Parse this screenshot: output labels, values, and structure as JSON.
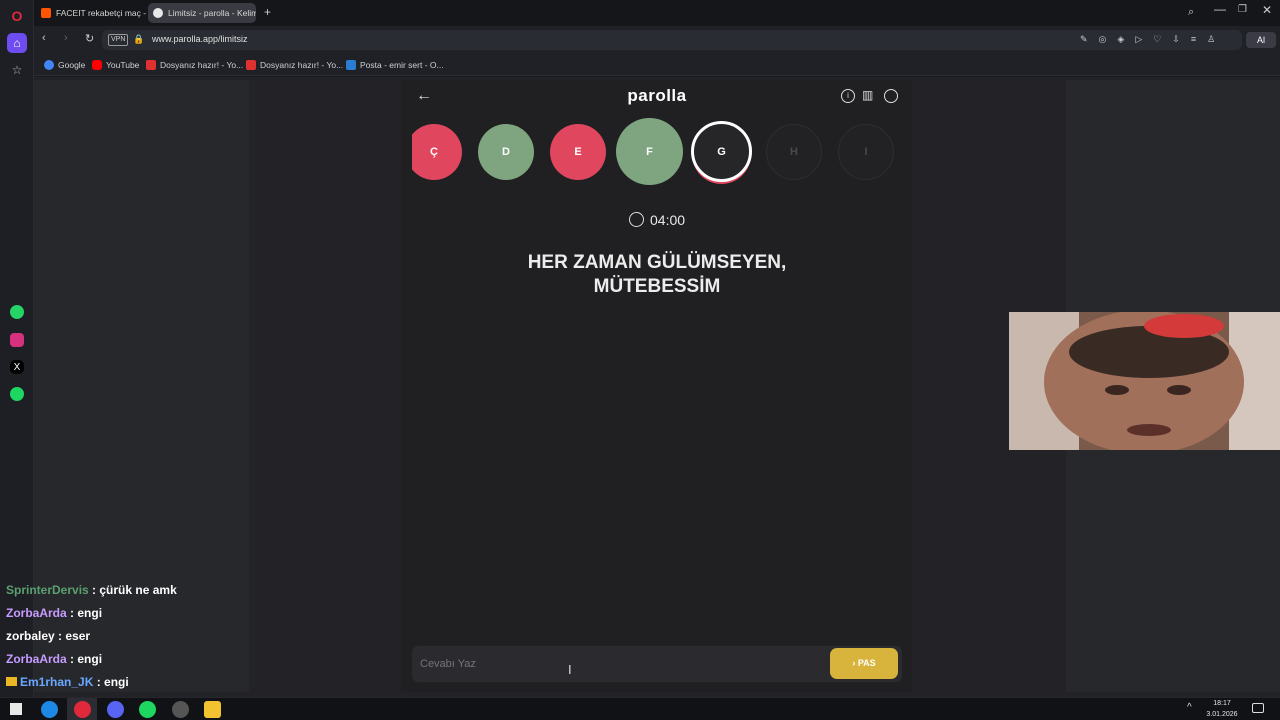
{
  "browser": {
    "tabs": [
      {
        "title": "FACEIT rekabetçi maç - FA"
      },
      {
        "title": "Limitsiz - parolla - Kelime"
      }
    ],
    "vpn_label": "VPN",
    "url": "www.parolla.app/limitsiz",
    "ai_label": "Al",
    "bookmarks": [
      {
        "label": "Google"
      },
      {
        "label": "YouTube"
      },
      {
        "label": "Dosyanız hazır! - Yo..."
      },
      {
        "label": "Dosyanız hazır! - Yo..."
      },
      {
        "label": "Posta - emir sert - O..."
      }
    ]
  },
  "game": {
    "title": "parolla",
    "letters": [
      {
        "letter": "Ç",
        "state": "wrong",
        "color": "#e0475e"
      },
      {
        "letter": "D",
        "state": "correct",
        "color": "#7ea57f"
      },
      {
        "letter": "E",
        "state": "wrong",
        "color": "#e0475e"
      },
      {
        "letter": "F",
        "state": "correct",
        "color": "#7ea57f"
      },
      {
        "letter": "G",
        "state": "active",
        "color": "#262628"
      },
      {
        "letter": "H",
        "state": "pending",
        "color": "#222225"
      },
      {
        "letter": "I",
        "state": "pending",
        "color": "#222225"
      }
    ],
    "timer": "04:00",
    "question_line1": "HER ZAMAN GÜLÜMSEYEN,",
    "question_line2": "MÜTEBESSİM",
    "answer_placeholder": "Cevabı Yaz",
    "pass_button": "PAS",
    "pass_color": "#d8b43c"
  },
  "chat": [
    {
      "user": "SprinterDervis",
      "sep": " : ",
      "msg": "çürük ne amk",
      "user_color": "#5aa06e"
    },
    {
      "user": "ZorbaArda",
      "sep": " : ",
      "msg": "engi",
      "user_color": "#c89bff"
    },
    {
      "user": "zorbaley",
      "sep": " : ",
      "msg": "eser",
      "user_color": "#ffffff"
    },
    {
      "user": "ZorbaArda",
      "sep": " : ",
      "msg": "engi",
      "user_color": "#c89bff"
    },
    {
      "user": "Em1rhan_JK",
      "sep": " : ",
      "msg": "engi",
      "user_color": "#6aa8ff"
    }
  ],
  "taskbar": {
    "time": "18:17",
    "date": "3.01.2026"
  }
}
